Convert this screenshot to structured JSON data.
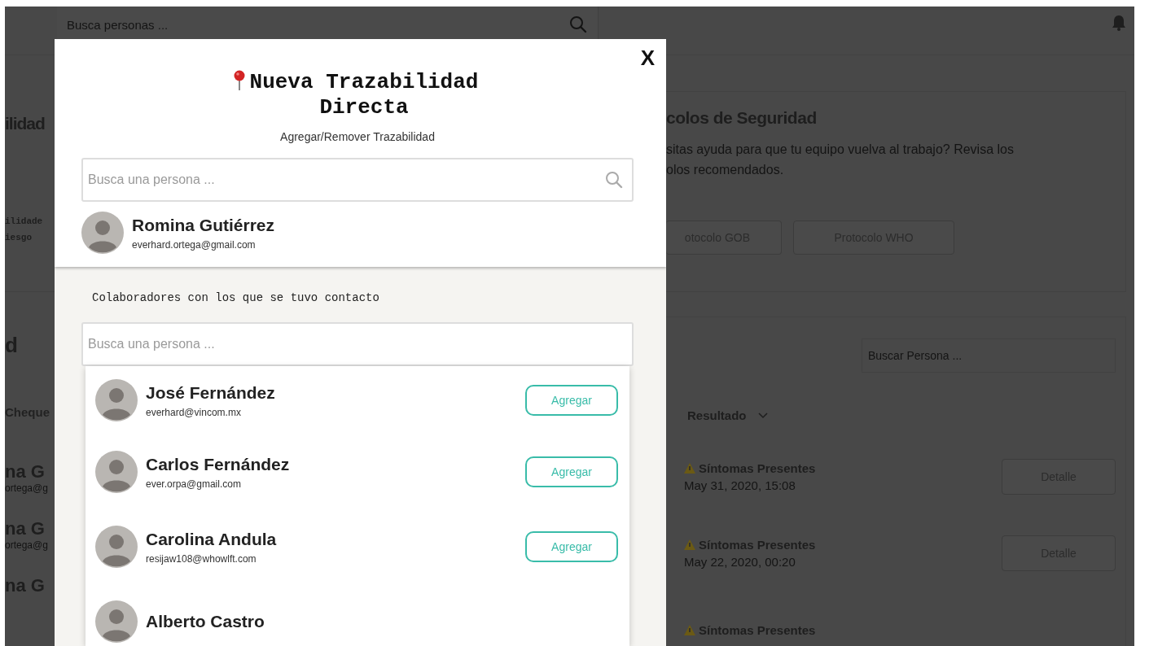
{
  "top_bar": {
    "search_placeholder": "Busca personas ..."
  },
  "left_card": {
    "title": "ilidad",
    "lines": [
      "ilidade",
      "iesgo"
    ]
  },
  "left_panel": {
    "title": "d",
    "column": "Cheque",
    "rows": [
      {
        "name": "na G",
        "email": "ortega@g"
      },
      {
        "name": "na G",
        "email": "ortega@g"
      },
      {
        "name": "na G"
      }
    ]
  },
  "protocols_card": {
    "title": "colos de Seguridad",
    "text_lines": [
      "sitas ayuda para que tu equipo vuelva al trabajo? Revisa los",
      "olos recomendados."
    ],
    "buttons": [
      "otocolo GOB",
      "Protocolo WHO"
    ]
  },
  "checks_panel": {
    "search_placeholder": "Buscar Persona ...",
    "column": "Resultado",
    "rows": [
      {
        "status": "Síntomas Presentes",
        "date": "May 31, 2020, 15:08",
        "action": "Detalle"
      },
      {
        "status": "Síntomas Presentes",
        "date": "May 22, 2020, 00:20",
        "action": "Detalle"
      },
      {
        "status": "Síntomas Presentes"
      }
    ]
  },
  "modal": {
    "close": "X",
    "title": "Nueva Trazabilidad Directa",
    "subtitle": "Agregar/Remover Trazabilidad",
    "search_placeholder": "Busca una persona ...",
    "selected_person": {
      "name": "Romina Gutiérrez",
      "email": "everhard.ortega@gmail.com"
    },
    "contacts_label": "Colaboradores con los que se tuvo contacto",
    "contacts_search_placeholder": "Busca una persona ...",
    "results": [
      {
        "name": "José Fernández",
        "email": "everhard@vincom.mx",
        "action": "Agregar"
      },
      {
        "name": "Carlos Fernández",
        "email": "ever.orpa@gmail.com",
        "action": "Agregar"
      },
      {
        "name": "Carolina Andula",
        "email": "resijaw108@whowlft.com",
        "action": "Agregar"
      },
      {
        "name": "Alberto Castro"
      }
    ]
  }
}
